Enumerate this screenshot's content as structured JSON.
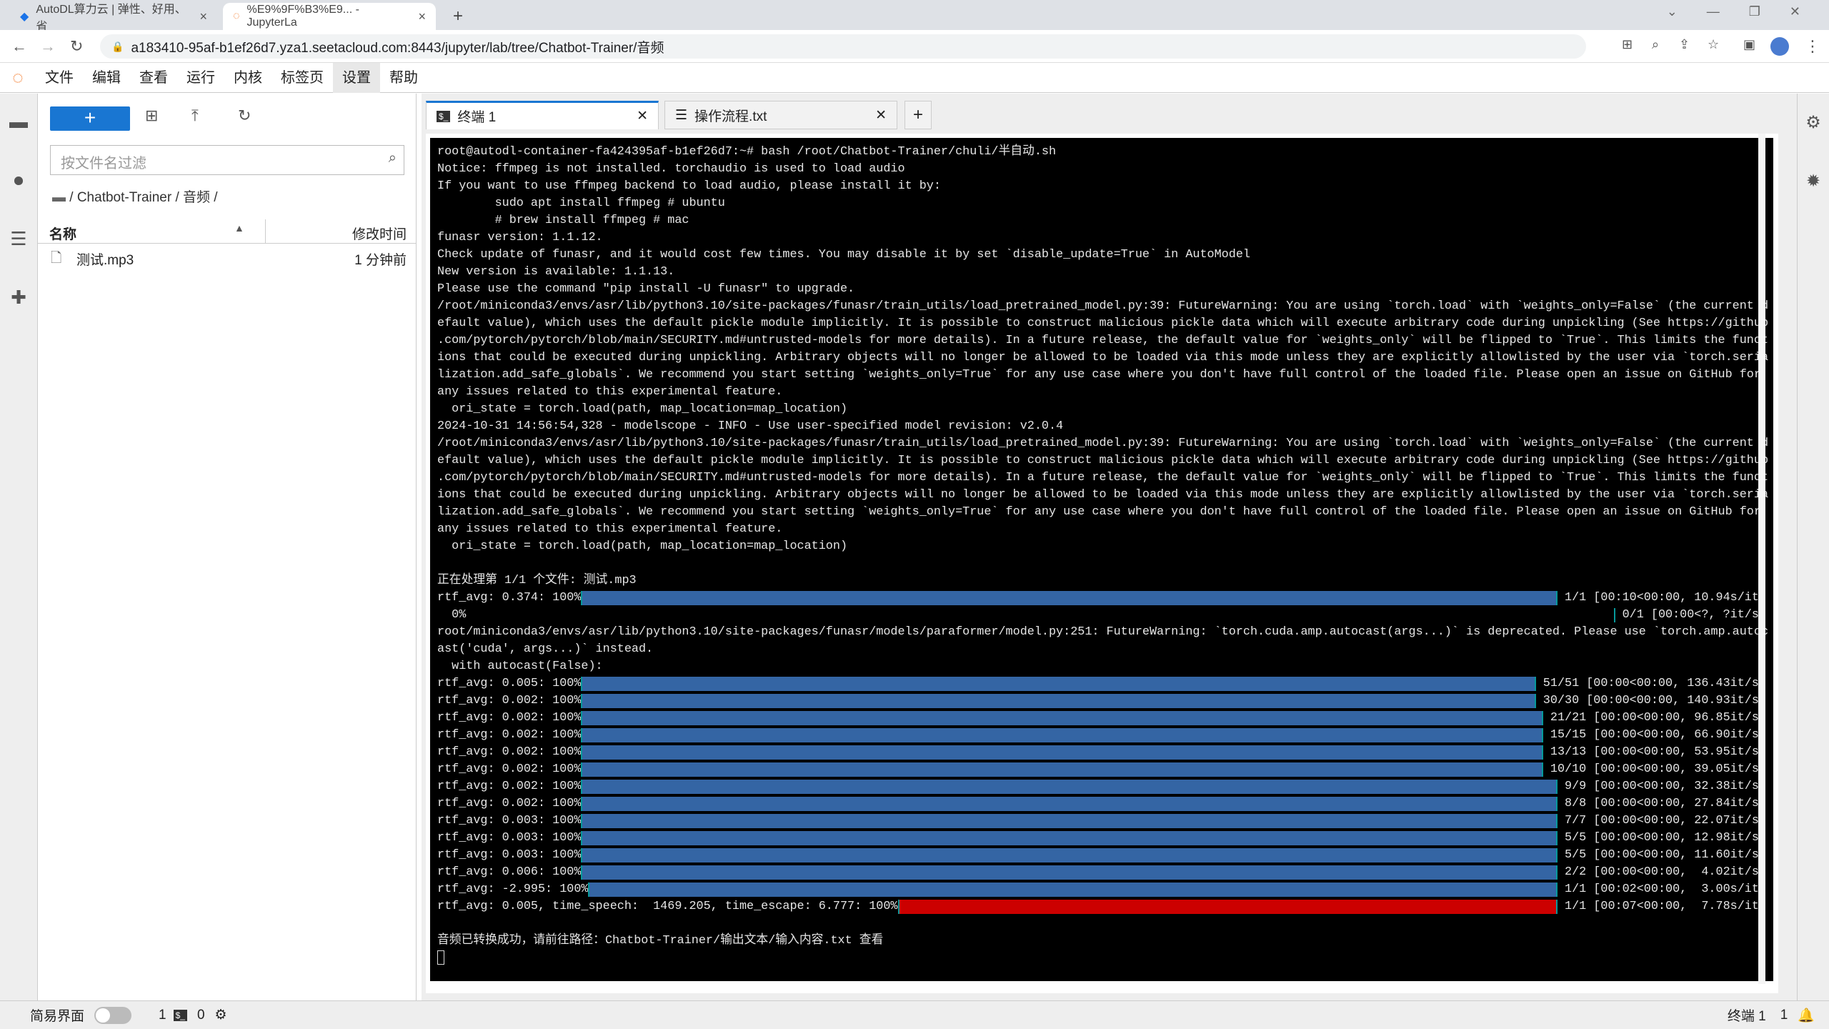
{
  "browser": {
    "tabs": [
      {
        "title": "AutoDL算力云 | 弹性、好用、省"
      },
      {
        "title": "%E9%9F%B3%E9... - JupyterLa"
      }
    ],
    "url": "a183410-95af-b1ef26d7.yza1.seetacloud.com:8443/jupyter/lab/tree/Chatbot-Trainer/音频"
  },
  "menu": [
    "文件",
    "编辑",
    "查看",
    "运行",
    "内核",
    "标签页",
    "设置",
    "帮助"
  ],
  "files": {
    "filter_placeholder": "按文件名过滤",
    "breadcrumb": "/ Chatbot-Trainer / 音频 /",
    "col_name": "名称",
    "col_modified": "修改时间",
    "items": [
      {
        "name": "测试.mp3",
        "modified": "1 分钟前"
      }
    ]
  },
  "tabs": [
    {
      "label": "终端 1"
    },
    {
      "label": "操作流程.txt"
    }
  ],
  "terminal": {
    "lines_top": [
      "root@autodl-container-fa424395af-b1ef26d7:~# bash /root/Chatbot-Trainer/chuli/半自动.sh",
      "Notice: ffmpeg is not installed. torchaudio is used to load audio",
      "If you want to use ffmpeg backend to load audio, please install it by:",
      "        sudo apt install ffmpeg # ubuntu",
      "        # brew install ffmpeg # mac",
      "funasr version: 1.1.12.",
      "Check update of funasr, and it would cost few times. You may disable it by set `disable_update=True` in AutoModel",
      "New version is available: 1.1.13.",
      "Please use the command \"pip install -U funasr\" to upgrade.",
      "/root/miniconda3/envs/asr/lib/python3.10/site-packages/funasr/train_utils/load_pretrained_model.py:39: FutureWarning: You are using `torch.load` with `weights_only=False` (the current d",
      "efault value), which uses the default pickle module implicitly. It is possible to construct malicious pickle data which will execute arbitrary code during unpickling (See https://github",
      ".com/pytorch/pytorch/blob/main/SECURITY.md#untrusted-models for more details). In a future release, the default value for `weights_only` will be flipped to `True`. This limits the funct",
      "ions that could be executed during unpickling. Arbitrary objects will no longer be allowed to be loaded via this mode unless they are explicitly allowlisted by the user via `torch.seria",
      "lization.add_safe_globals`. We recommend you start setting `weights_only=True` for any use case where you don't have full control of the loaded file. Please open an issue on GitHub for",
      "any issues related to this experimental feature.",
      "  ori_state = torch.load(path, map_location=map_location)",
      "2024-10-31 14:56:54,328 - modelscope - INFO - Use user-specified model revision: v2.0.4",
      "/root/miniconda3/envs/asr/lib/python3.10/site-packages/funasr/train_utils/load_pretrained_model.py:39: FutureWarning: You are using `torch.load` with `weights_only=False` (the current d",
      "efault value), which uses the default pickle module implicitly. It is possible to construct malicious pickle data which will execute arbitrary code during unpickling (See https://github",
      ".com/pytorch/pytorch/blob/main/SECURITY.md#untrusted-models for more details). In a future release, the default value for `weights_only` will be flipped to `True`. This limits the funct",
      "ions that could be executed during unpickling. Arbitrary objects will no longer be allowed to be loaded via this mode unless they are explicitly allowlisted by the user via `torch.seria",
      "lization.add_safe_globals`. We recommend you start setting `weights_only=True` for any use case where you don't have full control of the loaded file. Please open an issue on GitHub for",
      "any issues related to this experimental feature.",
      "  ori_state = torch.load(path, map_location=map_location)",
      "",
      "正在处理第 1/1 个文件: 测试.mp3"
    ],
    "pb1": {
      "prefix": "rtf_avg: 0.374: 100%",
      "suffix": " 1/1 [00:10<00:00, 10.94s/it]",
      "progress": 100
    },
    "pb0": {
      "prefix": "  0%",
      "suffix": " 0/1 [00:00<?, ?it/s/",
      "progress": 0
    },
    "lines_mid": [
      "root/miniconda3/envs/asr/lib/python3.10/site-packages/funasr/models/paraformer/model.py:251: FutureWarning: `torch.cuda.amp.autocast(args...)` is deprecated. Please use `torch.amp.autoc",
      "ast('cuda', args...)` instead.",
      "  with autocast(False):"
    ],
    "bars": [
      {
        "prefix": "rtf_avg: 0.005: 100%",
        "suffix": " 51/51 [00:00<00:00, 136.43it/s]"
      },
      {
        "prefix": "rtf_avg: 0.002: 100%",
        "suffix": " 30/30 [00:00<00:00, 140.93it/s]"
      },
      {
        "prefix": "rtf_avg: 0.002: 100%",
        "suffix": " 21/21 [00:00<00:00, 96.85it/s]"
      },
      {
        "prefix": "rtf_avg: 0.002: 100%",
        "suffix": " 15/15 [00:00<00:00, 66.90it/s]"
      },
      {
        "prefix": "rtf_avg: 0.002: 100%",
        "suffix": " 13/13 [00:00<00:00, 53.95it/s]"
      },
      {
        "prefix": "rtf_avg: 0.002: 100%",
        "suffix": " 10/10 [00:00<00:00, 39.05it/s]"
      },
      {
        "prefix": "rtf_avg: 0.002: 100%",
        "suffix": " 9/9 [00:00<00:00, 32.38it/s]"
      },
      {
        "prefix": "rtf_avg: 0.002: 100%",
        "suffix": " 8/8 [00:00<00:00, 27.84it/s]"
      },
      {
        "prefix": "rtf_avg: 0.003: 100%",
        "suffix": " 7/7 [00:00<00:00, 22.07it/s]"
      },
      {
        "prefix": "rtf_avg: 0.003: 100%",
        "suffix": " 5/5 [00:00<00:00, 12.98it/s]"
      },
      {
        "prefix": "rtf_avg: 0.003: 100%",
        "suffix": " 5/5 [00:00<00:00, 11.60it/s]"
      },
      {
        "prefix": "rtf_avg: 0.006: 100%",
        "suffix": " 2/2 [00:00<00:00,  4.02it/s]"
      },
      {
        "prefix": "rtf_avg: -2.995: 100%",
        "suffix": " 1/1 [00:02<00:00,  3.00s/it]"
      }
    ],
    "final_bar": {
      "prefix": "rtf_avg: 0.005, time_speech:  1469.205, time_escape: 6.777: 100%",
      "suffix": " 1/1 [00:07<00:00,  7.78s/it]",
      "progress": 100
    },
    "lines_end": [
      "",
      "音频已转换成功，请前往路径：Chatbot-Trainer/输出文本/输入内容.txt 查看"
    ],
    "colors": {
      "bar": "#3465a4",
      "final_bar": "#cc0000",
      "background": "#000000"
    }
  },
  "status": {
    "simple_mode": "简易界面",
    "terminals": "1",
    "kernels": "0",
    "right_label": "终端 1",
    "right_count": "1"
  }
}
